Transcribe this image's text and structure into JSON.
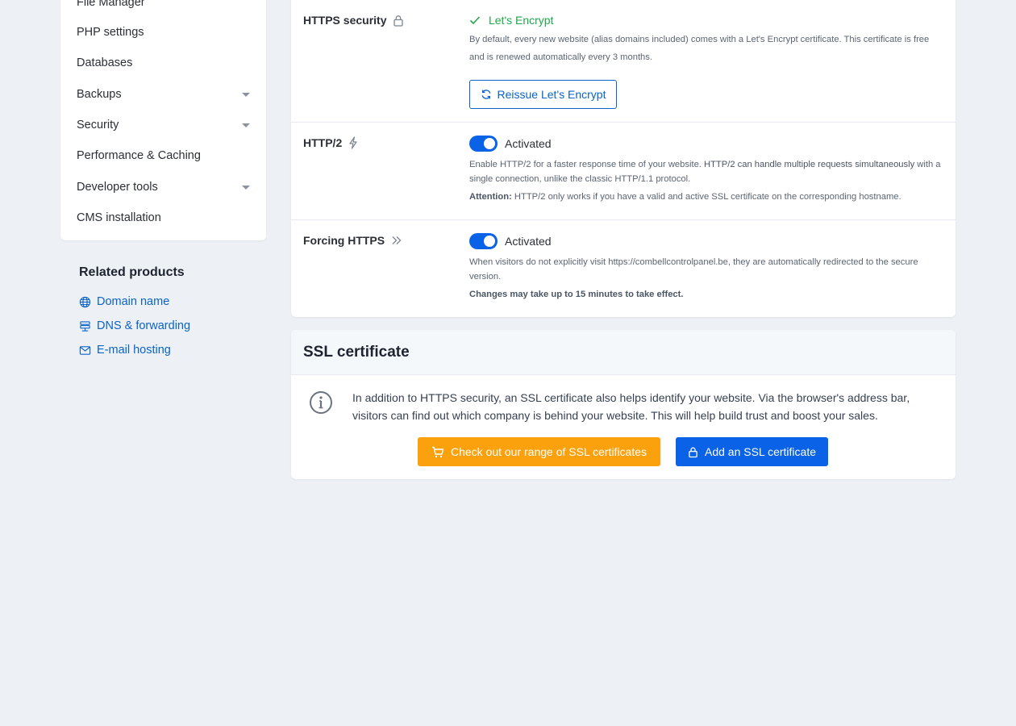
{
  "sidebar": {
    "items": [
      {
        "label": "File Manager",
        "has_caret": false
      },
      {
        "label": "PHP settings",
        "has_caret": false
      },
      {
        "label": "Databases",
        "has_caret": false
      },
      {
        "label": "Backups",
        "has_caret": true
      },
      {
        "label": "Security",
        "has_caret": true
      },
      {
        "label": "Performance & Caching",
        "has_caret": false
      },
      {
        "label": "Developer tools",
        "has_caret": true
      },
      {
        "label": "CMS installation",
        "has_caret": false
      }
    ]
  },
  "related": {
    "title": "Related products",
    "links": [
      {
        "label": "Domain name",
        "icon": "globe-icon"
      },
      {
        "label": "DNS & forwarding",
        "icon": "dns-icon"
      },
      {
        "label": "E-mail hosting",
        "icon": "mail-icon"
      }
    ]
  },
  "https_security": {
    "label": "HTTPS security",
    "icon": "lock-icon",
    "status": "Let's Encrypt",
    "status_icon": "check-icon",
    "description": "By default, every new website (alias domains included) comes with a Let's Encrypt certificate. This certificate is free and is renewed automatically every 3 months.",
    "button": "Reissue Let's Encrypt",
    "button_icon": "refresh-icon"
  },
  "http2": {
    "label": "HTTP/2",
    "icon": "lightning-icon",
    "toggle_label": "Activated",
    "toggle_on": true,
    "description_start": "Enable HTTP/2 for a faster response time of your website. ",
    "description_bold": "HTTP/2 can handle multiple requests simultaneously",
    "description_end": " with a single connection, unlike the classic HTTP/1.1 protocol.",
    "attention_label": "Attention:",
    "attention_text": " HTTP/2 only works if you have a valid and active SSL certificate on the corresponding hostname."
  },
  "forcing_https": {
    "label": "Forcing HTTPS",
    "icon": "double-chevron-right-icon",
    "toggle_label": "Activated",
    "toggle_on": true,
    "description": "When visitors do not explicitly visit https://combellcontrolpanel.be, they are automatically redirected to the secure version.",
    "note": "Changes may take up to 15 minutes to take effect."
  },
  "ssl": {
    "title": "SSL certificate",
    "info_icon": "info-icon",
    "text": "In addition to HTTPS security, an SSL certificate also helps identify your website. Via the browser's address bar, visitors can find out which company is behind your website. This will help build trust and boost your sales.",
    "btn_check": "Check out our range of SSL certificates",
    "btn_check_icon": "cart-icon",
    "btn_add": "Add an SSL certificate",
    "btn_add_icon": "lock-icon"
  },
  "colors": {
    "accent": "#0a63e6",
    "link": "#0a63c9",
    "success": "#1ea84a",
    "orange": "#fba10d",
    "background": "#edf1f5"
  }
}
